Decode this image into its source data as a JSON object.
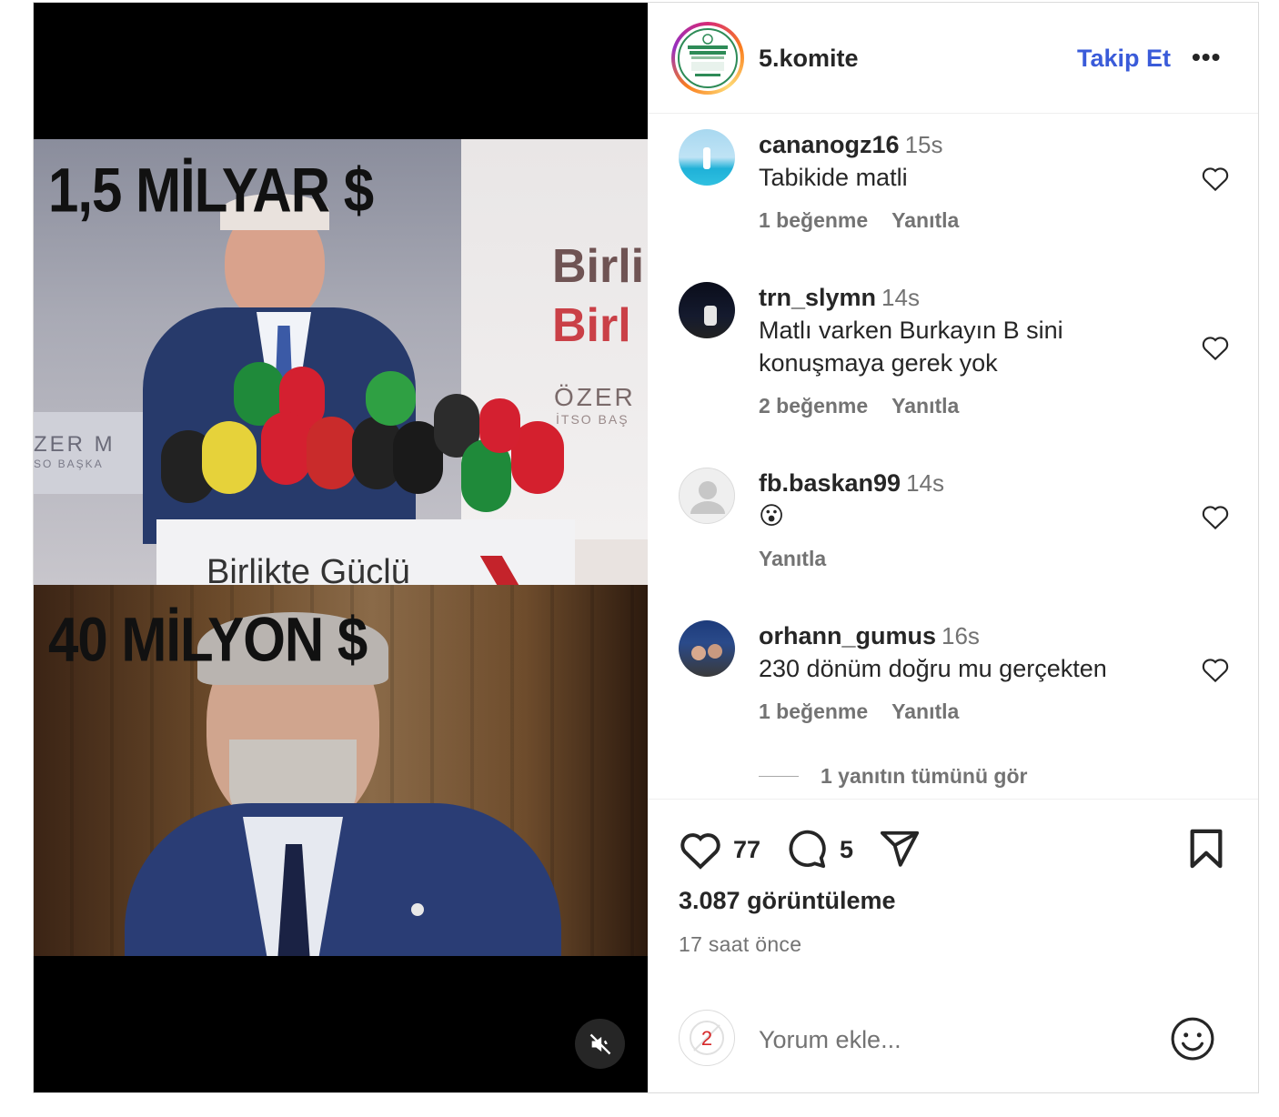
{
  "post": {
    "author": "5.komite",
    "follow_label": "Takip Et",
    "more_label": "•••",
    "media": {
      "top_caption": "1,5 MİLYAR $",
      "bottom_caption": "40 MİLYON $",
      "mute_icon": "speaker-muted-icon"
    }
  },
  "comments": [
    {
      "user": "cananogz16",
      "time": "15s",
      "text": "Tabikide matli",
      "likes": "1 beğenme",
      "reply": "Yanıtla"
    },
    {
      "user": "trn_slymn",
      "time": "14s",
      "text": "Matlı varken Burkayın B sini konuşmaya gerek yok",
      "likes": "2 beğenme",
      "reply": "Yanıtla"
    },
    {
      "user": "fb.baskan99",
      "time": "14s",
      "text": "😮",
      "likes": "",
      "reply": "Yanıtla"
    },
    {
      "user": "orhann_gumus",
      "time": "16s",
      "text": "230 dönüm doğru mu gerçekten",
      "likes": "1 beğenme",
      "reply": "Yanıtla"
    }
  ],
  "view_replies": "1 yanıtın tümünü gör",
  "actions": {
    "like_count": "77",
    "comment_count": "5",
    "views": "3.087 görüntüleme",
    "time_ago": "17 saat önce"
  },
  "composer": {
    "placeholder": "Yorum ekle...",
    "badge": "2"
  }
}
